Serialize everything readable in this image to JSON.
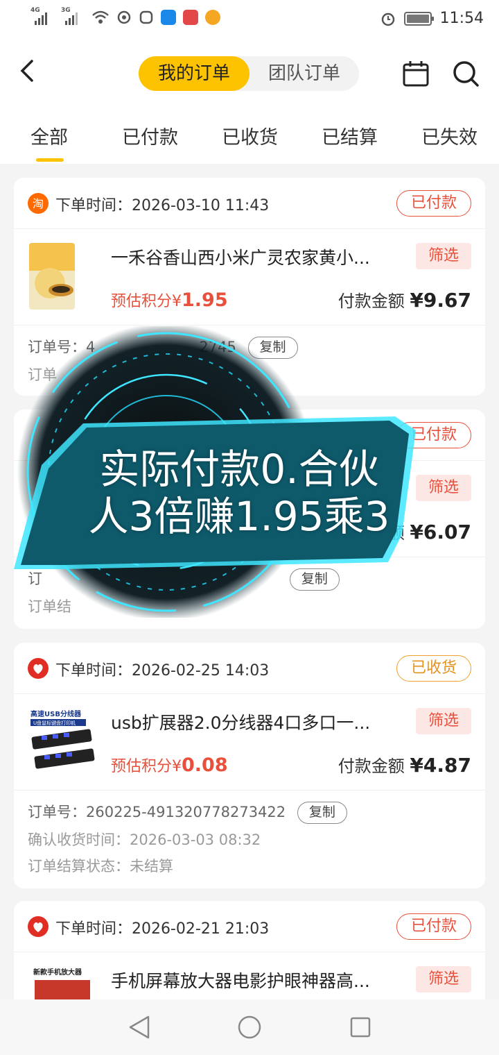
{
  "status_bar": {
    "network_1": "4G",
    "network_2": "3G",
    "time": "11:54"
  },
  "header": {
    "tab_active": "我的订单",
    "tab_inactive": "团队订单"
  },
  "filter_tabs": [
    {
      "label": "全部",
      "active": true
    },
    {
      "label": "已付款",
      "active": false
    },
    {
      "label": "已收货",
      "active": false
    },
    {
      "label": "已结算",
      "active": false
    },
    {
      "label": "已失效",
      "active": false
    }
  ],
  "orders": [
    {
      "shop_icon": "taobao-icon",
      "time_label": "下单时间：2026-03-10 11:43",
      "status": "已付款",
      "name": "一禾谷香山西小米广灵农家黄小...",
      "filter": "筛选",
      "points_label": "预估积分¥",
      "points_value": "1.95",
      "amount_label": "付款金额",
      "amount_value": "¥9.67",
      "order_no_label": "订单号：4",
      "order_no_tail": "2745",
      "copy": "复制",
      "extra_label": "订单"
    },
    {
      "status": "已付款",
      "filter": "筛选",
      "amount_label": "额",
      "amount_value": "¥6.07",
      "copy": "复制",
      "order_no_label": "订",
      "extra_label": "订单结"
    },
    {
      "shop_icon": "pinduoduo-icon",
      "time_label": "下单时间：2026-02-25 14:03",
      "status": "已收货",
      "name": "usb扩展器2.0分线器4口多口一...",
      "thumb_title": "高速USB分线器",
      "thumb_sub": "U盘鼠标键盘打印机",
      "filter": "筛选",
      "points_label": "预估积分¥",
      "points_value": "0.08",
      "amount_label": "付款金额",
      "amount_value": "¥4.87",
      "order_no_label": "订单号：",
      "order_no": "260225-491320778273422",
      "copy": "复制",
      "confirm_label": "确认收货时间：",
      "confirm_value": "2026-03-03 08:32",
      "settle_label": "订单结算状态：",
      "settle_value": "未结算"
    },
    {
      "shop_icon": "pinduoduo-icon",
      "time_label": "下单时间：2026-02-21 21:03",
      "status": "已付款",
      "name": "手机屏幕放大器电影护眼神器高...",
      "thumb_title": "新款手机放大器",
      "filter": "筛选"
    }
  ],
  "overlay": {
    "line1": "实际付款0.合伙",
    "line2": "人3倍赚1.95乘3"
  },
  "colors": {
    "accent_yellow": "#fdc300",
    "red": "#e8503b",
    "orange": "#e6921e",
    "overlay_teal": "#0e5a6b",
    "overlay_cyan": "#3ee6ff"
  }
}
